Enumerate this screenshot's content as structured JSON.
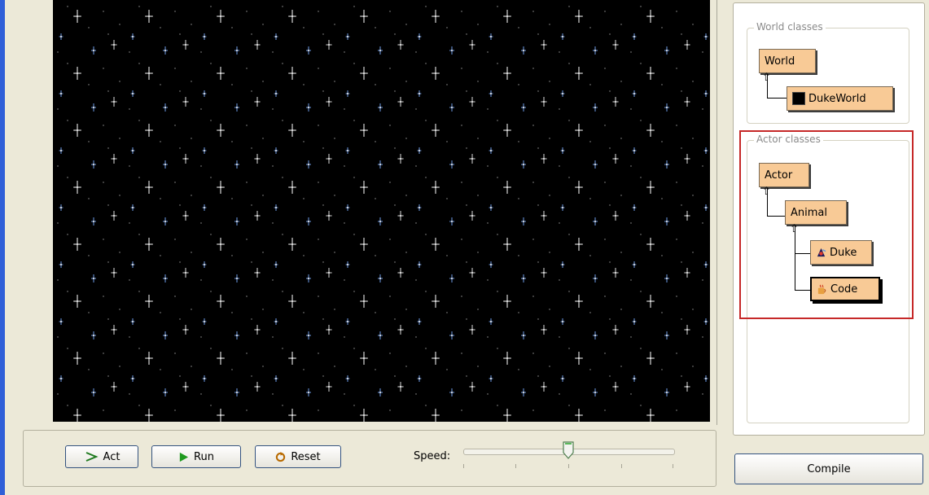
{
  "controls": {
    "act_label": "Act",
    "run_label": "Run",
    "reset_label": "Reset",
    "speed_label": "Speed:",
    "speed_value": 0.5
  },
  "class_browser": {
    "world_group_title": "World classes",
    "actor_group_title": "Actor classes",
    "world_classes": [
      {
        "name": "World",
        "icon": ""
      },
      {
        "name": "DukeWorld",
        "icon": "starfield-thumbnail-icon"
      }
    ],
    "actor_classes": [
      {
        "name": "Actor",
        "icon": ""
      },
      {
        "name": "Animal",
        "icon": ""
      },
      {
        "name": "Duke",
        "icon": "duke-mascot-icon"
      },
      {
        "name": "Code",
        "icon": "code-cup-icon",
        "selected": true
      }
    ]
  },
  "compile_label": "Compile",
  "colors": {
    "world_background": "#000000",
    "class_box": "#f8ca96",
    "highlight": "#c62828",
    "accent_blue": "#2f5fd8"
  }
}
